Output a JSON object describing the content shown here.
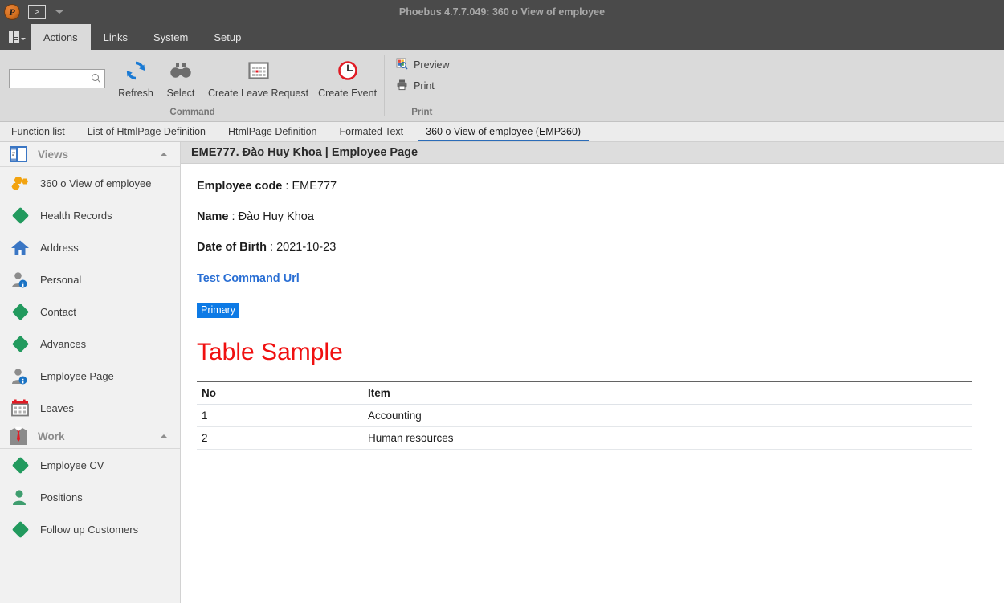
{
  "window": {
    "title": "Phoebus 4.7.7.049: 360 o View of employee",
    "logo_letter": "P",
    "quick_access_label": ">"
  },
  "ribbon": {
    "tabs": [
      {
        "label": "Actions",
        "active": true
      },
      {
        "label": "Links",
        "active": false
      },
      {
        "label": "System",
        "active": false
      },
      {
        "label": "Setup",
        "active": false
      }
    ],
    "search": {
      "value": "",
      "placeholder": ""
    },
    "groups": [
      {
        "label": "Command",
        "buttons": [
          {
            "label": "Refresh",
            "icon": "refresh-icon"
          },
          {
            "label": "Select",
            "icon": "binoculars-icon"
          },
          {
            "label": "Create Leave Request",
            "icon": "calendar-icon"
          },
          {
            "label": "Create Event",
            "icon": "clock-icon"
          }
        ]
      },
      {
        "label": "Print",
        "items": [
          {
            "label": "Preview",
            "icon": "preview-icon"
          },
          {
            "label": "Print",
            "icon": "printer-icon"
          }
        ]
      }
    ]
  },
  "doc_tabs": [
    {
      "label": "Function list",
      "active": false
    },
    {
      "label": "List of HtmlPage Definition",
      "active": false
    },
    {
      "label": "HtmlPage Definition",
      "active": false
    },
    {
      "label": "Formated Text",
      "active": false
    },
    {
      "label": "360 o View of employee (EMP360)",
      "active": true
    }
  ],
  "sidebar": {
    "sections": [
      {
        "title": "Views",
        "icon": "views-panel-icon",
        "items": [
          {
            "label": "360 o View of employee",
            "icon": "hexagons-icon"
          },
          {
            "label": "Health Records",
            "icon": "diamond-icon"
          },
          {
            "label": "Address",
            "icon": "home-icon"
          },
          {
            "label": "Personal",
            "icon": "person-info-icon"
          },
          {
            "label": "Contact",
            "icon": "diamond-icon"
          },
          {
            "label": "Advances",
            "icon": "diamond-icon"
          },
          {
            "label": "Employee Page",
            "icon": "person-info-icon"
          },
          {
            "label": "Leaves",
            "icon": "calendar-icon"
          }
        ]
      },
      {
        "title": "Work",
        "icon": "suit-tie-icon",
        "items": [
          {
            "label": "Employee CV",
            "icon": "diamond-icon"
          },
          {
            "label": "Positions",
            "icon": "person-icon"
          },
          {
            "label": "Follow up Customers",
            "icon": "diamond-icon"
          }
        ]
      }
    ]
  },
  "page": {
    "header": "EME777. Đào Huy Khoa  | Employee Page",
    "fields": [
      {
        "label": "Employee code",
        "separator": " : ",
        "value": "EME777"
      },
      {
        "label": "Name",
        "separator": " : ",
        "value": "Đào Huy Khoa"
      },
      {
        "label": "Date of Birth",
        "separator": " : ",
        "value": "2021-10-23"
      }
    ],
    "command_link": "Test Command Url",
    "badge": "Primary",
    "table_title": "Table Sample",
    "table": {
      "columns": [
        "No",
        "Item"
      ],
      "rows": [
        [
          "1",
          "Accounting"
        ],
        [
          "2",
          "Human resources"
        ]
      ]
    }
  },
  "colors": {
    "titlebar": "#4a4a4a",
    "ribbon": "#dadada",
    "accent_tab": "#2b6cb8",
    "link": "#2a6fd4",
    "badge": "#0d7ae5",
    "table_title": "#f01010",
    "green": "#229a5e",
    "orange": "#f2a30f",
    "blue_icon": "#3a76c4",
    "red_icon": "#e01b24"
  }
}
